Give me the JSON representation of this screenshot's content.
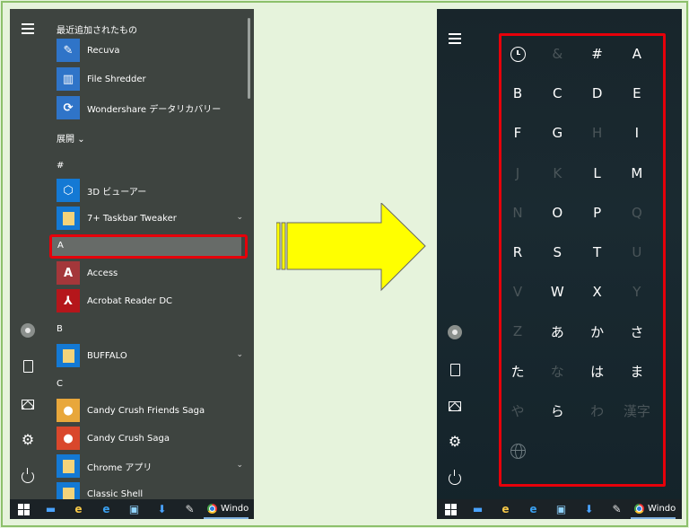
{
  "left_panel": {
    "recent_header": "最近追加されたもの",
    "recent_apps": [
      {
        "name": "Recuva",
        "icon": "recuva-icon"
      },
      {
        "name": "File Shredder",
        "icon": "file-shredder-icon"
      },
      {
        "name": "Wondershare データリカバリー",
        "icon": "wondershare-icon"
      }
    ],
    "expand_label": "展開",
    "groups": [
      {
        "letter": "#"
      },
      {
        "letter": "A"
      },
      {
        "letter": "B"
      },
      {
        "letter": "C"
      }
    ],
    "apps": [
      {
        "name": "3D ビューアー",
        "icon": "cube-icon"
      },
      {
        "name": "7+ Taskbar Tweaker",
        "icon": "folder-icon"
      },
      {
        "name": "Access",
        "icon": "access-icon"
      },
      {
        "name": "Acrobat Reader DC",
        "icon": "acrobat-icon"
      },
      {
        "name": "BUFFALO",
        "icon": "folder-icon"
      },
      {
        "name": "Candy Crush Friends Saga",
        "icon": "candy-friends-icon"
      },
      {
        "name": "Candy Crush Saga",
        "icon": "candy-icon"
      },
      {
        "name": "Chrome アプリ",
        "icon": "folder-icon"
      },
      {
        "name": "Classic Shell",
        "icon": "folder-icon"
      }
    ],
    "taskbar": {
      "chrome_label": "Windo"
    }
  },
  "right_panel": {
    "grid": [
      [
        "clock",
        "&",
        "#",
        "A"
      ],
      [
        "B",
        "C",
        "D",
        "E"
      ],
      [
        "F",
        "G",
        "H",
        "I"
      ],
      [
        "J",
        "K",
        "L",
        "M"
      ],
      [
        "N",
        "O",
        "P",
        "Q"
      ],
      [
        "R",
        "S",
        "T",
        "U"
      ],
      [
        "V",
        "W",
        "X",
        "Y"
      ],
      [
        "Z",
        "あ",
        "か",
        "さ"
      ],
      [
        "た",
        "な",
        "は",
        "ま"
      ],
      [
        "や",
        "ら",
        "わ",
        "漢字"
      ],
      [
        "globe"
      ]
    ],
    "disabled": [
      "&",
      "H",
      "J",
      "K",
      "N",
      "Q",
      "U",
      "V",
      "Y",
      "Z",
      "な",
      "や",
      "わ",
      "漢字",
      "globe"
    ],
    "taskbar": {
      "chrome_label": "Windo"
    }
  },
  "colors": {
    "highlight": "#e6000a",
    "arrow_fill": "#ffff00",
    "background": "#e6f3dc"
  }
}
